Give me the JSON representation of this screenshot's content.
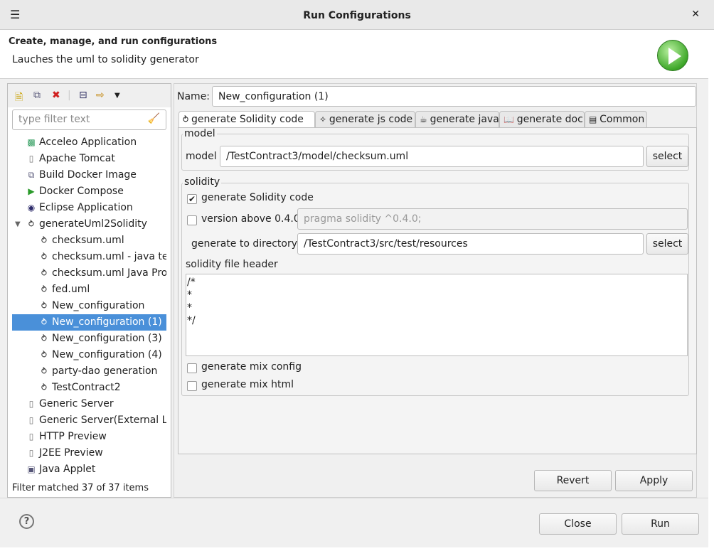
{
  "window": {
    "title": "Run Configurations",
    "menu_icon": "hamburger-icon",
    "close_icon": "close-icon"
  },
  "header": {
    "title": "Create, manage, and run configurations",
    "description": "Lauches the uml to solidity generator"
  },
  "left": {
    "toolbar": [
      "new-config-icon",
      "duplicate-icon",
      "delete-icon",
      "collapse-all-icon",
      "filter-icon",
      "dropdown-icon"
    ],
    "filter_placeholder": "type filter text",
    "tree": [
      {
        "label": "Acceleo Application",
        "icon": "acceleo-icon",
        "level": 0
      },
      {
        "label": "Apache Tomcat",
        "icon": "server-icon",
        "level": 0
      },
      {
        "label": "Build Docker Image",
        "icon": "docker-build-icon",
        "level": 0
      },
      {
        "label": "Docker Compose",
        "icon": "run-icon",
        "level": 0
      },
      {
        "label": "Eclipse Application",
        "icon": "eclipse-icon",
        "level": 0
      },
      {
        "label": "generateUml2Solidity",
        "icon": "solidity-icon",
        "level": 0,
        "expanded": true
      },
      {
        "label": "checksum.uml",
        "icon": "solidity-icon",
        "level": 1
      },
      {
        "label": "checksum.uml - java test",
        "icon": "solidity-icon",
        "level": 1
      },
      {
        "label": "checksum.uml Java Proj",
        "icon": "solidity-icon",
        "level": 1
      },
      {
        "label": "fed.uml",
        "icon": "solidity-icon",
        "level": 1
      },
      {
        "label": "New_configuration",
        "icon": "solidity-icon",
        "level": 1
      },
      {
        "label": "New_configuration (1)",
        "icon": "solidity-icon",
        "level": 1,
        "selected": true
      },
      {
        "label": "New_configuration (3)",
        "icon": "solidity-icon",
        "level": 1
      },
      {
        "label": "New_configuration (4)",
        "icon": "solidity-icon",
        "level": 1
      },
      {
        "label": "party-dao generation",
        "icon": "solidity-icon",
        "level": 1
      },
      {
        "label": "TestContract2",
        "icon": "solidity-icon",
        "level": 1
      },
      {
        "label": "Generic Server",
        "icon": "server-icon",
        "level": 0
      },
      {
        "label": "Generic Server(External La",
        "icon": "server-icon",
        "level": 0
      },
      {
        "label": "HTTP Preview",
        "icon": "server-icon",
        "level": 0
      },
      {
        "label": "J2EE Preview",
        "icon": "server-icon",
        "level": 0
      },
      {
        "label": "Java Applet",
        "icon": "applet-icon",
        "level": 0
      }
    ],
    "status": "Filter matched 37 of 37 items"
  },
  "right": {
    "name_label": "Name:",
    "name_value": "New_configuration (1)",
    "tabs": [
      {
        "label": "generate Solidity code",
        "icon": "solidity-icon",
        "active": true
      },
      {
        "label": "generate js code",
        "icon": "js-icon"
      },
      {
        "label": "generate java",
        "icon": "java-icon"
      },
      {
        "label": "generate doc",
        "icon": "book-icon"
      },
      {
        "label": "Common",
        "icon": "common-icon"
      }
    ],
    "model": {
      "group": "model",
      "label": "model",
      "value": "/TestContract3/model/checksum.uml",
      "button": "select"
    },
    "solidity": {
      "group": "solidity",
      "generate_code": {
        "label": "generate Solidity code",
        "checked": true
      },
      "version_above": {
        "label": "version above 0.4.0",
        "checked": false,
        "value": "pragma solidity ^0.4.0;"
      },
      "directory_label": "generate to directory",
      "directory_value": "/TestContract3/src/test/resources",
      "directory_button": "select",
      "header_label": "solidity file header",
      "header_value": "/*\n*\n*\n*/",
      "mix_config": {
        "label": "generate mix config",
        "checked": false
      },
      "mix_html": {
        "label": "generate mix html",
        "checked": false
      }
    },
    "revert": "Revert",
    "apply": "Apply"
  },
  "footer": {
    "help_icon": "help-icon",
    "help_glyph": "?",
    "close": "Close",
    "run": "Run"
  }
}
